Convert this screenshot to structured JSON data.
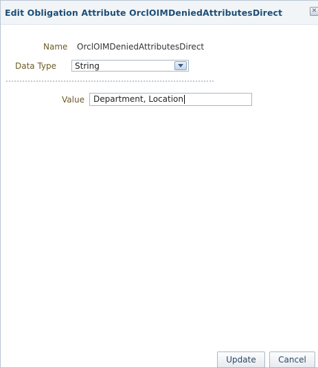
{
  "dialog": {
    "title": "Edit Obligation Attribute OrclOIMDeniedAttributesDirect",
    "close_icon": "close-icon"
  },
  "form": {
    "name_label": "Name",
    "name_value": "OrclOIMDeniedAttributesDirect",
    "datatype_label": "Data Type",
    "datatype_value": "String",
    "value_label": "Value",
    "value_text": "Department, Location"
  },
  "buttons": {
    "update": "Update",
    "cancel": "Cancel"
  }
}
